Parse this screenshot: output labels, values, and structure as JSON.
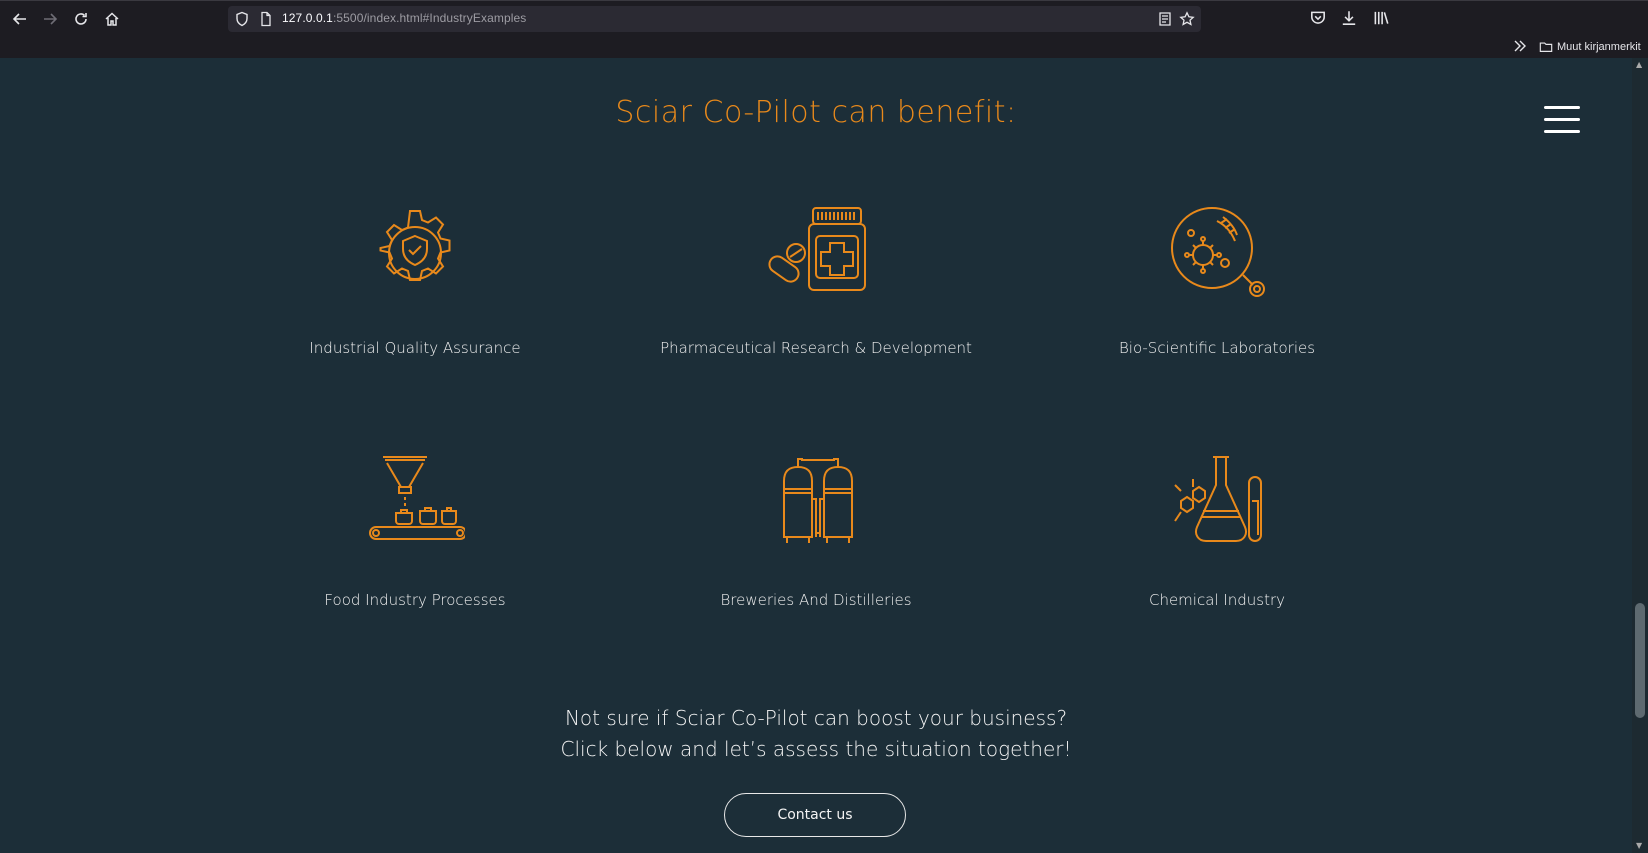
{
  "browser": {
    "url_host": "127.0.0.1",
    "url_rest": ":5500/index.html#IndustryExamples",
    "bookmarks_folder": "Muut kirjanmerkit"
  },
  "page": {
    "title": "Sciar Co-Pilot can benefit:",
    "industries": [
      {
        "label": "Industrial Quality Assurance",
        "icon": "gear-shield-icon"
      },
      {
        "label": "Pharmaceutical Research & Development",
        "icon": "medicine-bottle-icon"
      },
      {
        "label": "Bio-Scientific Laboratories",
        "icon": "virus-magnifier-icon"
      },
      {
        "label": "Food Industry Processes",
        "icon": "conveyor-funnel-icon"
      },
      {
        "label": "Breweries And Distilleries",
        "icon": "brewery-tanks-icon"
      },
      {
        "label": "Chemical Industry",
        "icon": "flask-testtube-icon"
      }
    ],
    "cta_line1": "Not sure if Sciar Co-Pilot can boost your business?",
    "cta_line2": "Click below and let’s assess the situation together!",
    "contact_label": "Contact us"
  },
  "colors": {
    "accent": "#e8891b",
    "background": "#1c2e38",
    "text": "#f0f0f0"
  }
}
